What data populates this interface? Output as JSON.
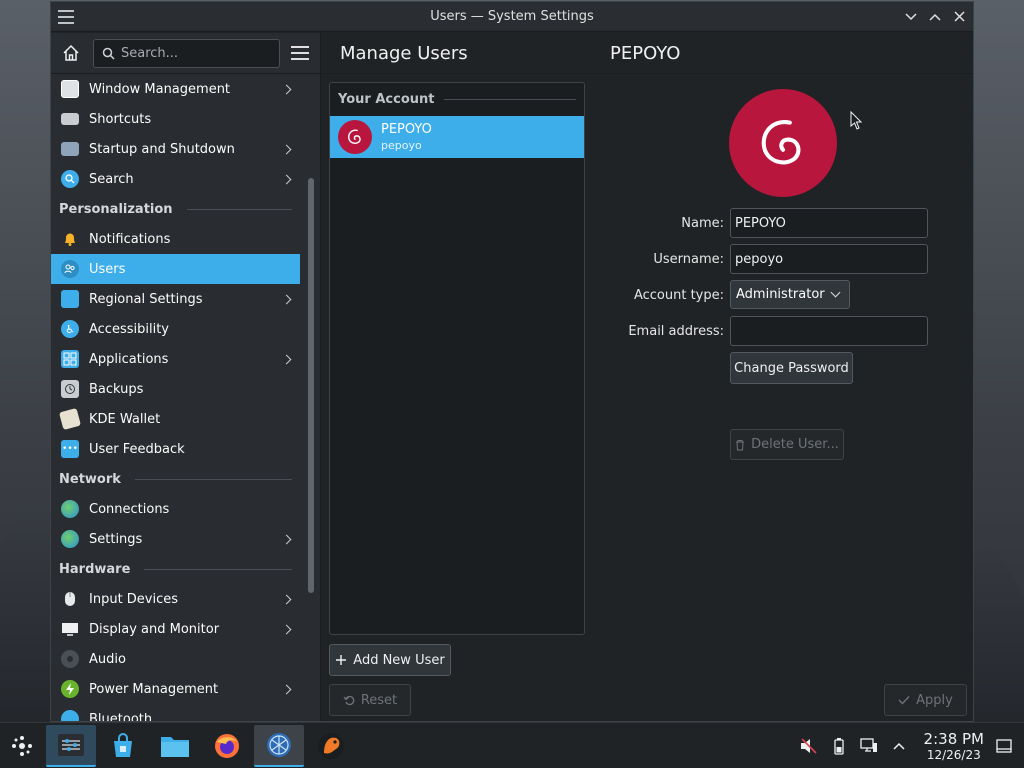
{
  "window": {
    "title": "Users — System Settings"
  },
  "sidebar": {
    "search_placeholder": "Search...",
    "items": [
      {
        "label": "Window Management",
        "icon": "window-management-icon",
        "has_children": true
      },
      {
        "label": "Shortcuts",
        "icon": "keyboard-icon",
        "has_children": false
      },
      {
        "label": "Startup and Shutdown",
        "icon": "startup-icon",
        "has_children": true
      },
      {
        "label": "Search",
        "icon": "search-icon",
        "has_children": true
      }
    ],
    "sections": [
      {
        "title": "Personalization",
        "items": [
          {
            "label": "Notifications",
            "icon": "bell-icon",
            "has_children": false
          },
          {
            "label": "Users",
            "icon": "users-icon",
            "has_children": false,
            "active": true
          },
          {
            "label": "Regional Settings",
            "icon": "regional-icon",
            "has_children": true
          },
          {
            "label": "Accessibility",
            "icon": "accessibility-icon",
            "has_children": false
          },
          {
            "label": "Applications",
            "icon": "applications-icon",
            "has_children": true
          },
          {
            "label": "Backups",
            "icon": "backup-icon",
            "has_children": false
          },
          {
            "label": "KDE Wallet",
            "icon": "wallet-icon",
            "has_children": false
          },
          {
            "label": "User Feedback",
            "icon": "feedback-icon",
            "has_children": false
          }
        ]
      },
      {
        "title": "Network",
        "items": [
          {
            "label": "Connections",
            "icon": "globe-icon",
            "has_children": false
          },
          {
            "label": "Settings",
            "icon": "globe-icon",
            "has_children": true
          }
        ]
      },
      {
        "title": "Hardware",
        "items": [
          {
            "label": "Input Devices",
            "icon": "mouse-icon",
            "has_children": true
          },
          {
            "label": "Display and Monitor",
            "icon": "monitor-icon",
            "has_children": true
          },
          {
            "label": "Audio",
            "icon": "speaker-icon",
            "has_children": false
          },
          {
            "label": "Power Management",
            "icon": "power-icon",
            "has_children": true
          },
          {
            "label": "Bluetooth",
            "icon": "bluetooth-icon",
            "has_children": false
          }
        ]
      }
    ]
  },
  "main": {
    "title": "Manage Users",
    "selected_user_header": "PEPOYO",
    "list_section": "Your Account",
    "users": [
      {
        "name": "PEPOYO",
        "username": "pepoyo",
        "selected": true
      }
    ],
    "form": {
      "name_label": "Name:",
      "name_value": "PEPOYO",
      "username_label": "Username:",
      "username_value": "pepoyo",
      "account_type_label": "Account type:",
      "account_type_value": "Administrator",
      "email_label": "Email address:",
      "email_value": "",
      "change_password": "Change Password",
      "delete_user": "Delete User..."
    },
    "add_user": "Add New User",
    "reset": "Reset",
    "apply": "Apply"
  },
  "taskbar": {
    "apps": [
      "system-settings",
      "discover",
      "dolphin",
      "firefox",
      "network-app",
      "tux-app"
    ],
    "time": "2:38 PM",
    "date": "12/26/23"
  },
  "colors": {
    "accent": "#3daee9",
    "debian_red": "#b8163c",
    "window_bg": "#202326",
    "sidebar_bg": "#292c30"
  }
}
